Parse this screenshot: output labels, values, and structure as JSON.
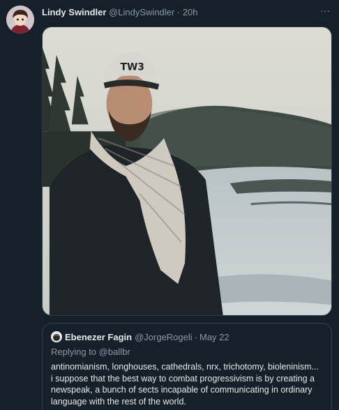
{
  "tweet": {
    "author_name": "Lindy Swindler",
    "author_handle": "@LindySwindler",
    "separator": "·",
    "time": "20h",
    "more_label": "···"
  },
  "media": {
    "cap_text": "TW3"
  },
  "quoted_tweet": {
    "author_name": "Ebenezer Fagin",
    "author_handle": "@JorgeRogeli",
    "separator": "·",
    "time": "May 22",
    "replying_prefix": "Replying to ",
    "replying_to": "@ballbr",
    "body": "antinomianism, longhouses, cathedrals, nrx, trichotomy, bioleninism... i suppose that the best way to combat progressivism is by creating a newspeak, a bunch of sects incapable of communicating in ordinary language with the rest of the world."
  },
  "colors": {
    "background": "#15202b",
    "primary_text": "#e7e9ea",
    "secondary_text": "#8b98a5",
    "border": "#38444d"
  }
}
